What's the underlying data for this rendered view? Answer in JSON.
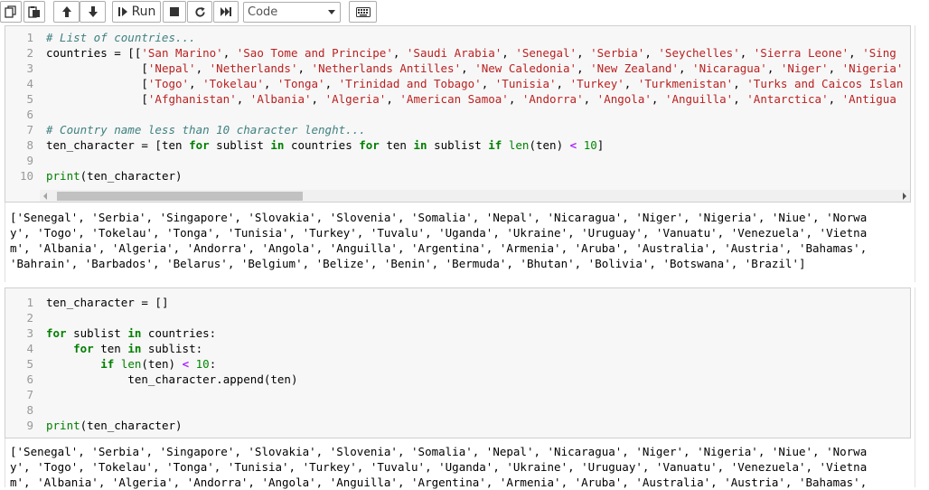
{
  "toolbar": {
    "run_label": "Run",
    "cell_type": "Code",
    "icons": [
      "copy-icon",
      "paste-icon",
      "move-up-icon",
      "move-down-icon",
      "run-icon",
      "stop-icon",
      "restart-icon",
      "fast-forward-icon",
      "keyboard-icon"
    ]
  },
  "cell1": {
    "line_numbers": [
      "1",
      "2",
      "3",
      "4",
      "5",
      "6",
      "7",
      "8",
      "9",
      "10"
    ],
    "lines": [
      "# List of countries...",
      "countries = [['San Marino', 'Sao Tome and Principe', 'Saudi Arabia', 'Senegal', 'Serbia', 'Seychelles', 'Sierra Leone', 'Sing",
      "              ['Nepal', 'Netherlands', 'Netherlands Antilles', 'New Caledonia', 'New Zealand', 'Nicaragua', 'Niger', 'Nigeria'",
      "              ['Togo', 'Tokelau', 'Tonga', 'Trinidad and Tobago', 'Tunisia', 'Turkey', 'Turkmenistan', 'Turks and Caicos Islan",
      "              ['Afghanistan', 'Albania', 'Algeria', 'American Samoa', 'Andorra', 'Angola', 'Anguilla', 'Antarctica', 'Antigua",
      "",
      "# Country name less than 10 character lenght...",
      "ten_character = [ten for sublist in countries for ten in sublist if len(ten) < 10]",
      "",
      "print(ten_character)"
    ],
    "output": [
      "['Senegal', 'Serbia', 'Singapore', 'Slovakia', 'Slovenia', 'Somalia', 'Nepal', 'Nicaragua', 'Niger', 'Nigeria', 'Niue', 'Norwa",
      "y', 'Togo', 'Tokelau', 'Tonga', 'Tunisia', 'Turkey', 'Tuvalu', 'Uganda', 'Ukraine', 'Uruguay', 'Vanuatu', 'Venezuela', 'Vietna",
      "m', 'Albania', 'Algeria', 'Andorra', 'Angola', 'Anguilla', 'Argentina', 'Armenia', 'Aruba', 'Australia', 'Austria', 'Bahamas',",
      "'Bahrain', 'Barbados', 'Belarus', 'Belgium', 'Belize', 'Benin', 'Bermuda', 'Bhutan', 'Bolivia', 'Botswana', 'Brazil']"
    ]
  },
  "cell2": {
    "line_numbers": [
      "1",
      "2",
      "3",
      "4",
      "5",
      "6",
      "7",
      "8",
      "9"
    ],
    "lines": [
      "ten_character = []",
      "",
      "for sublist in countries:",
      "    for ten in sublist:",
      "        if len(ten) < 10:",
      "            ten_character.append(ten)",
      "",
      "",
      "print(ten_character)"
    ],
    "output": [
      "['Senegal', 'Serbia', 'Singapore', 'Slovakia', 'Slovenia', 'Somalia', 'Nepal', 'Nicaragua', 'Niger', 'Nigeria', 'Niue', 'Norwa",
      "y', 'Togo', 'Tokelau', 'Tonga', 'Tunisia', 'Turkey', 'Tuvalu', 'Uganda', 'Ukraine', 'Uruguay', 'Vanuatu', 'Venezuela', 'Vietna",
      "m', 'Albania', 'Algeria', 'Andorra', 'Angola', 'Anguilla', 'Argentina', 'Armenia', 'Aruba', 'Australia', 'Austria', 'Bahamas',"
    ]
  },
  "colors": {
    "comment": "#408080",
    "string": "#ba2121",
    "keyword": "#008000",
    "number": "#008800",
    "operator": "#aa22ff"
  }
}
